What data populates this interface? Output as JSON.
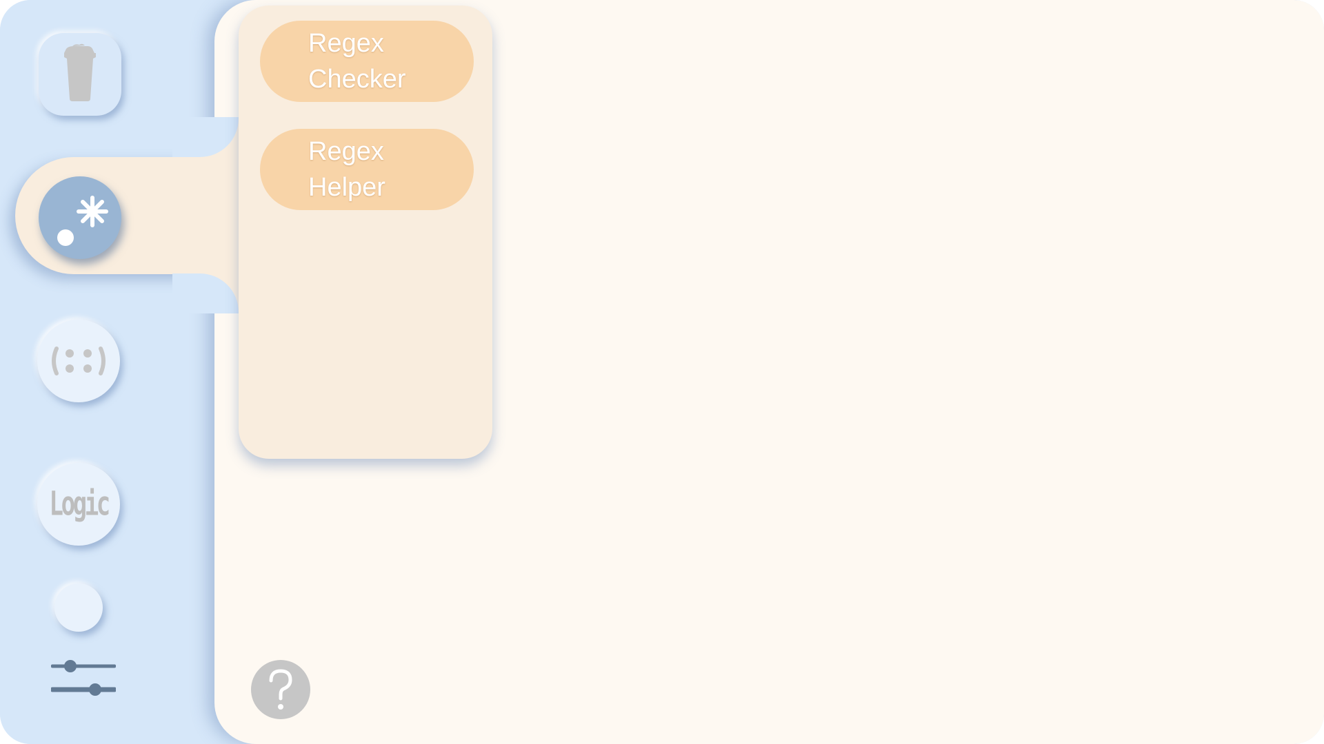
{
  "sidebar": {
    "items": [
      {
        "name": "trash",
        "icon": "trash-icon"
      },
      {
        "name": "regex",
        "icon": "regex-icon",
        "active": true
      },
      {
        "name": "groups",
        "icon": "group-icon"
      },
      {
        "name": "logic",
        "icon": "logic-icon",
        "label": "Logic"
      },
      {
        "name": "theme",
        "icon": "circle-icon"
      },
      {
        "name": "settings",
        "icon": "sliders-icon"
      }
    ]
  },
  "submenu": {
    "items": [
      {
        "label": "Regex Checker"
      },
      {
        "label": "Regex Helper"
      }
    ]
  },
  "help": {
    "icon": "question-icon"
  },
  "colors": {
    "sidebar_bg": "#d6e7f9",
    "main_bg": "#fef9f2",
    "submenu_bg": "#f9edde",
    "submenu_item": "#f8d4a8",
    "active_button": "#99b5d3",
    "icon_gray": "#c6c6c6"
  }
}
